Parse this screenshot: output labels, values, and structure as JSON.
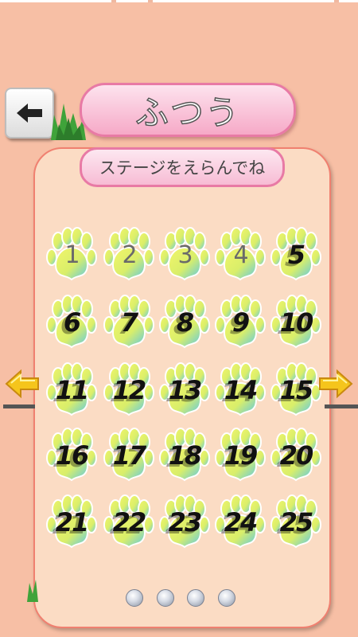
{
  "header": {
    "back_icon": "left-arrow-icon",
    "title": "ふつう"
  },
  "panel": {
    "subtitle": "ステージをえらんでね",
    "stages": [
      {
        "label": "1",
        "locked": true
      },
      {
        "label": "2",
        "locked": true
      },
      {
        "label": "3",
        "locked": true
      },
      {
        "label": "4",
        "locked": true
      },
      {
        "label": "5",
        "locked": false
      },
      {
        "label": "6",
        "locked": false
      },
      {
        "label": "7",
        "locked": false
      },
      {
        "label": "8",
        "locked": false
      },
      {
        "label": "9",
        "locked": false
      },
      {
        "label": "10",
        "locked": false
      },
      {
        "label": "11",
        "locked": false
      },
      {
        "label": "12",
        "locked": false
      },
      {
        "label": "13",
        "locked": false
      },
      {
        "label": "14",
        "locked": false
      },
      {
        "label": "15",
        "locked": false
      },
      {
        "label": "16",
        "locked": false
      },
      {
        "label": "17",
        "locked": false
      },
      {
        "label": "18",
        "locked": false
      },
      {
        "label": "19",
        "locked": false
      },
      {
        "label": "20",
        "locked": false
      },
      {
        "label": "21",
        "locked": false
      },
      {
        "label": "22",
        "locked": false
      },
      {
        "label": "23",
        "locked": false
      },
      {
        "label": "24",
        "locked": false
      },
      {
        "label": "25",
        "locked": false
      }
    ],
    "page_count": 4,
    "current_page": 1
  },
  "nav": {
    "prev_icon": "yellow-left-arrow-icon",
    "next_icon": "yellow-right-arrow-icon"
  },
  "colors": {
    "background": "#f7bfa5",
    "panel": "#fbdcc4",
    "pill_border": "#e87aa5",
    "paw_yellow": "#e8f060",
    "paw_blue": "#5cc8e6"
  }
}
